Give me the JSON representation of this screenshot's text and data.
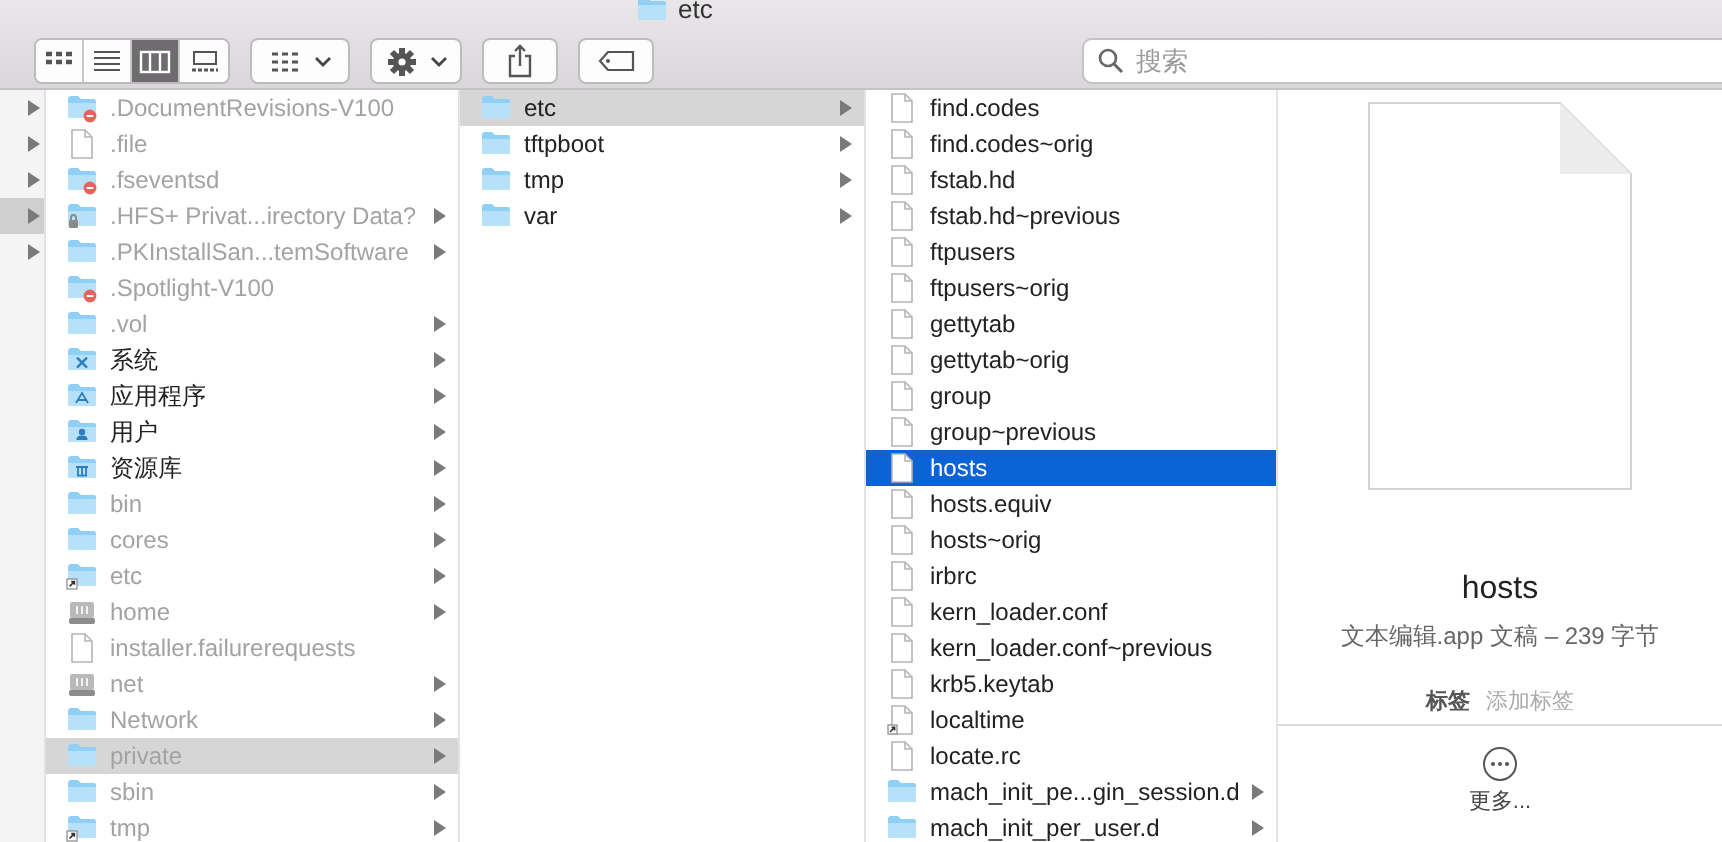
{
  "window": {
    "title": "etc"
  },
  "toolbar": {
    "view_modes": [
      {
        "kind": "icons",
        "selected": false
      },
      {
        "kind": "list",
        "selected": false
      },
      {
        "kind": "columns",
        "selected": true
      },
      {
        "kind": "gallery",
        "selected": false
      }
    ],
    "search": {
      "placeholder": "搜索"
    }
  },
  "browser": {
    "columns": [
      {
        "items": [
          {
            "has_children": true,
            "selected": false
          },
          {
            "has_children": true,
            "selected": false
          },
          {
            "has_children": true,
            "selected": false
          },
          {
            "has_children": true,
            "selected": true
          },
          {
            "has_children": true,
            "selected": false
          }
        ]
      },
      {
        "items": [
          {
            "name": ".DocumentRevisions-V100",
            "kind": "folder-blocked",
            "dimmed": true,
            "has_children": false,
            "selected": false
          },
          {
            "name": ".file",
            "kind": "file",
            "dimmed": true,
            "has_children": false,
            "selected": false
          },
          {
            "name": ".fseventsd",
            "kind": "folder-blocked",
            "dimmed": true,
            "has_children": false,
            "selected": false
          },
          {
            "name": ".HFS+ Privat...irectory Data?",
            "kind": "folder-locked",
            "dimmed": true,
            "has_children": true,
            "selected": false
          },
          {
            "name": ".PKInstallSan...temSoftware",
            "kind": "folder",
            "dimmed": true,
            "has_children": true,
            "selected": false
          },
          {
            "name": ".Spotlight-V100",
            "kind": "folder-blocked",
            "dimmed": true,
            "has_children": false,
            "selected": false
          },
          {
            "name": ".vol",
            "kind": "folder",
            "dimmed": true,
            "has_children": true,
            "selected": false
          },
          {
            "name": "系统",
            "kind": "folder-system",
            "dimmed": false,
            "has_children": true,
            "selected": false
          },
          {
            "name": "应用程序",
            "kind": "folder-apps",
            "dimmed": false,
            "has_children": true,
            "selected": false
          },
          {
            "name": "用户",
            "kind": "folder-users",
            "dimmed": false,
            "has_children": true,
            "selected": false
          },
          {
            "name": "资源库",
            "kind": "folder-library",
            "dimmed": false,
            "has_children": true,
            "selected": false
          },
          {
            "name": "bin",
            "kind": "folder",
            "dimmed": true,
            "has_children": true,
            "selected": false
          },
          {
            "name": "cores",
            "kind": "folder",
            "dimmed": true,
            "has_children": true,
            "selected": false
          },
          {
            "name": "etc",
            "kind": "folder-alias",
            "dimmed": true,
            "has_children": true,
            "selected": false
          },
          {
            "name": "home",
            "kind": "drive",
            "dimmed": true,
            "has_children": true,
            "selected": false
          },
          {
            "name": "installer.failurerequests",
            "kind": "file",
            "dimmed": true,
            "has_children": false,
            "selected": false
          },
          {
            "name": "net",
            "kind": "drive",
            "dimmed": true,
            "has_children": true,
            "selected": false
          },
          {
            "name": "Network",
            "kind": "folder",
            "dimmed": true,
            "has_children": true,
            "selected": false
          },
          {
            "name": "private",
            "kind": "folder",
            "dimmed": true,
            "has_children": true,
            "selected": true
          },
          {
            "name": "sbin",
            "kind": "folder",
            "dimmed": true,
            "has_children": true,
            "selected": false
          },
          {
            "name": "tmp",
            "kind": "folder-alias",
            "dimmed": true,
            "has_children": true,
            "selected": false
          }
        ]
      },
      {
        "items": [
          {
            "name": "etc",
            "kind": "folder",
            "dimmed": false,
            "has_children": true,
            "selected": true
          },
          {
            "name": "tftpboot",
            "kind": "folder",
            "dimmed": false,
            "has_children": true,
            "selected": false
          },
          {
            "name": "tmp",
            "kind": "folder",
            "dimmed": false,
            "has_children": true,
            "selected": false
          },
          {
            "name": "var",
            "kind": "folder",
            "dimmed": false,
            "has_children": true,
            "selected": false
          }
        ]
      },
      {
        "items": [
          {
            "name": "find.codes",
            "kind": "file",
            "dimmed": false,
            "has_children": false,
            "selected": false
          },
          {
            "name": "find.codes~orig",
            "kind": "file",
            "dimmed": false,
            "has_children": false,
            "selected": false
          },
          {
            "name": "fstab.hd",
            "kind": "file",
            "dimmed": false,
            "has_children": false,
            "selected": false
          },
          {
            "name": "fstab.hd~previous",
            "kind": "file",
            "dimmed": false,
            "has_children": false,
            "selected": false
          },
          {
            "name": "ftpusers",
            "kind": "file",
            "dimmed": false,
            "has_children": false,
            "selected": false
          },
          {
            "name": "ftpusers~orig",
            "kind": "file",
            "dimmed": false,
            "has_children": false,
            "selected": false
          },
          {
            "name": "gettytab",
            "kind": "file",
            "dimmed": false,
            "has_children": false,
            "selected": false
          },
          {
            "name": "gettytab~orig",
            "kind": "file",
            "dimmed": false,
            "has_children": false,
            "selected": false
          },
          {
            "name": "group",
            "kind": "file",
            "dimmed": false,
            "has_children": false,
            "selected": false
          },
          {
            "name": "group~previous",
            "kind": "file",
            "dimmed": false,
            "has_children": false,
            "selected": false
          },
          {
            "name": "hosts",
            "kind": "file",
            "dimmed": false,
            "has_children": false,
            "selected": true
          },
          {
            "name": "hosts.equiv",
            "kind": "file",
            "dimmed": false,
            "has_children": false,
            "selected": false
          },
          {
            "name": "hosts~orig",
            "kind": "file",
            "dimmed": false,
            "has_children": false,
            "selected": false
          },
          {
            "name": "irbrc",
            "kind": "file",
            "dimmed": false,
            "has_children": false,
            "selected": false
          },
          {
            "name": "kern_loader.conf",
            "kind": "file",
            "dimmed": false,
            "has_children": false,
            "selected": false
          },
          {
            "name": "kern_loader.conf~previous",
            "kind": "file",
            "dimmed": false,
            "has_children": false,
            "selected": false
          },
          {
            "name": "krb5.keytab",
            "kind": "file",
            "dimmed": false,
            "has_children": false,
            "selected": false
          },
          {
            "name": "localtime",
            "kind": "file-alias",
            "dimmed": false,
            "has_children": false,
            "selected": false
          },
          {
            "name": "locate.rc",
            "kind": "file",
            "dimmed": false,
            "has_children": false,
            "selected": false
          },
          {
            "name": "mach_init_pe...gin_session.d",
            "kind": "folder",
            "dimmed": false,
            "has_children": true,
            "selected": false
          },
          {
            "name": "mach_init_per_user.d",
            "kind": "folder",
            "dimmed": false,
            "has_children": true,
            "selected": false
          }
        ]
      }
    ]
  },
  "preview": {
    "name": "hosts",
    "info": "文本编辑.app 文稿 – 239 字节",
    "tags_label": "标签",
    "tags_placeholder": "添加标签",
    "more": "更多..."
  }
}
